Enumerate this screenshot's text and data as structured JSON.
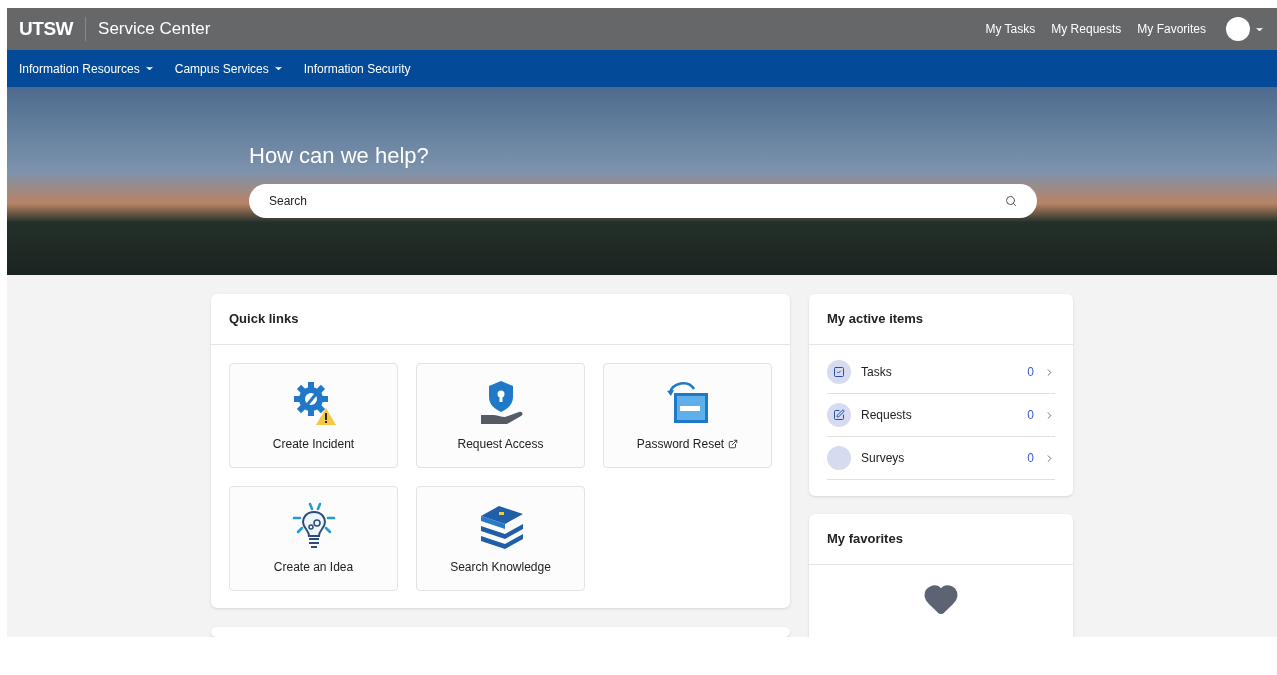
{
  "header": {
    "logo": "UTSW",
    "title": "Service Center",
    "links": [
      "My Tasks",
      "My Requests",
      "My Favorites"
    ]
  },
  "nav": [
    {
      "label": "Information Resources",
      "dropdown": true
    },
    {
      "label": "Campus Services",
      "dropdown": true
    },
    {
      "label": "Information Security",
      "dropdown": false
    }
  ],
  "hero": {
    "heading": "How can we help?",
    "search": {
      "placeholder": "Search"
    }
  },
  "quick_links": {
    "title": "Quick links",
    "items": [
      {
        "label": "Create Incident",
        "kind": "incident",
        "external": false
      },
      {
        "label": "Request Access",
        "kind": "access",
        "external": false
      },
      {
        "label": "Password Reset",
        "kind": "password",
        "external": true
      },
      {
        "label": "Create an Idea",
        "kind": "idea",
        "external": false
      },
      {
        "label": "Search Knowledge",
        "kind": "knowledge",
        "external": false
      }
    ]
  },
  "active_items": {
    "title": "My active items",
    "items": [
      {
        "label": "Tasks",
        "count": "0",
        "kind": "check"
      },
      {
        "label": "Requests",
        "count": "0",
        "kind": "edit"
      },
      {
        "label": "Surveys",
        "count": "0",
        "kind": "blank"
      }
    ]
  },
  "favorites": {
    "title": "My favorites"
  }
}
